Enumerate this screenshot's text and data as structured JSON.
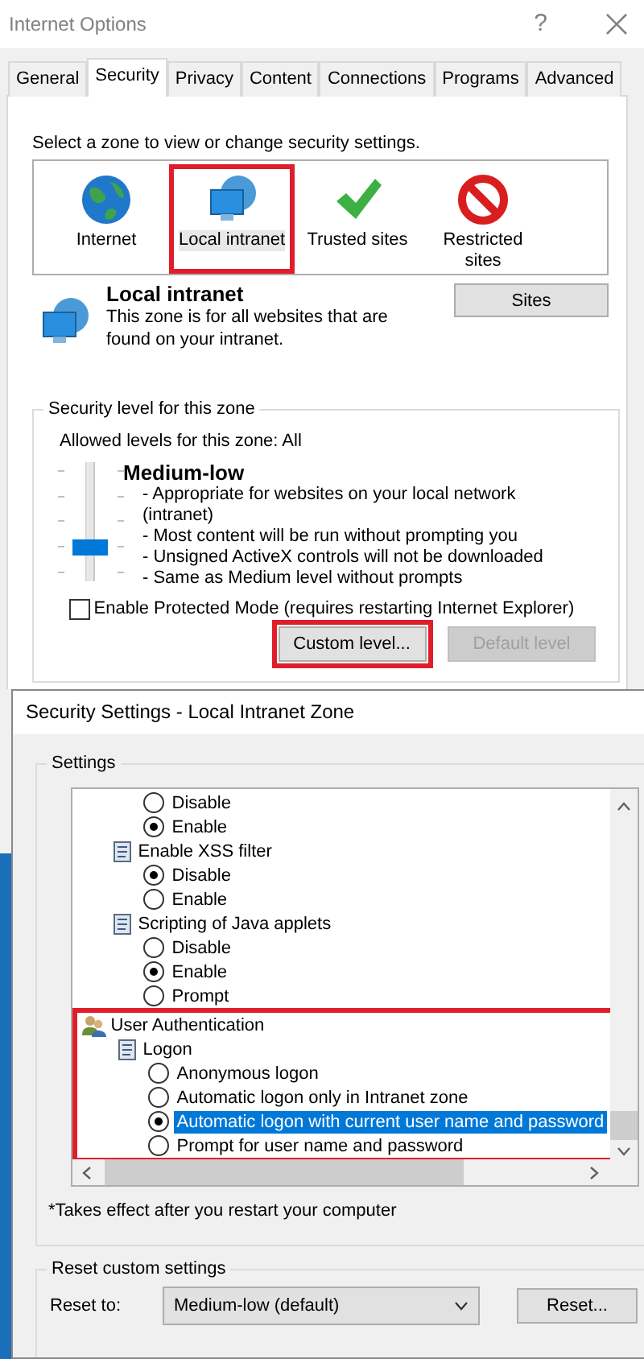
{
  "window": {
    "title": "Internet Options",
    "help": "?"
  },
  "tabs": [
    {
      "label": "General",
      "selected": false
    },
    {
      "label": "Security",
      "selected": true
    },
    {
      "label": "Privacy",
      "selected": false
    },
    {
      "label": "Content",
      "selected": false
    },
    {
      "label": "Connections",
      "selected": false
    },
    {
      "label": "Programs",
      "selected": false
    },
    {
      "label": "Advanced",
      "selected": false
    }
  ],
  "zone_prompt": "Select a zone to view or change security settings.",
  "zones": [
    {
      "label": "Internet",
      "kind": "globe",
      "selected": false,
      "highlighted": false
    },
    {
      "label": "Local intranet",
      "kind": "intranet",
      "selected": true,
      "highlighted": true
    },
    {
      "label": "Trusted sites",
      "kind": "trusted",
      "selected": false,
      "highlighted": false
    },
    {
      "label": "Restricted sites",
      "kind": "restricted",
      "selected": false,
      "highlighted": false
    }
  ],
  "zone_info": {
    "title": "Local intranet",
    "description": "This zone is for all websites that are found on your intranet.",
    "button": "Sites"
  },
  "security_level": {
    "legend": "Security level for this zone",
    "allowed": "Allowed levels for this zone: All",
    "level": 0.25,
    "name": "Medium-low",
    "bullets": [
      "- Appropriate for websites on your local network (intranet)",
      "- Most content will be run without prompting you",
      "- Unsigned ActiveX controls will not be downloaded",
      "- Same as Medium level without prompts"
    ]
  },
  "protected_mode": {
    "label": "Enable Protected Mode (requires restarting Internet Explorer)",
    "checked": false
  },
  "buttons": [
    {
      "label": "Custom level...",
      "disabled": false,
      "highlighted": true
    },
    {
      "label": "Default level",
      "disabled": true,
      "highlighted": false
    }
  ],
  "dialog": {
    "title": "Security Settings - Local Intranet Zone",
    "settings_legend": "Settings",
    "tree": [
      {
        "kind": "radio",
        "label": "Disable",
        "checked": false,
        "selected": false
      },
      {
        "kind": "radio",
        "label": "Enable",
        "checked": true,
        "selected": false
      },
      {
        "kind": "setting",
        "label": "Enable XSS filter",
        "children": [
          {
            "kind": "radio",
            "label": "Disable",
            "checked": true,
            "selected": false
          },
          {
            "kind": "radio",
            "label": "Enable",
            "checked": false,
            "selected": false
          }
        ]
      },
      {
        "kind": "setting",
        "label": "Scripting of Java applets",
        "children": [
          {
            "kind": "radio",
            "label": "Disable",
            "checked": false,
            "selected": false
          },
          {
            "kind": "radio",
            "label": "Enable",
            "checked": true,
            "selected": false
          },
          {
            "kind": "radio",
            "label": "Prompt",
            "checked": false,
            "selected": false
          }
        ]
      },
      {
        "kind": "category",
        "label": "User Authentication",
        "highlighted": true,
        "children": [
          {
            "kind": "setting",
            "label": "Logon",
            "children": [
              {
                "kind": "radio",
                "label": "Anonymous logon",
                "checked": false,
                "selected": false
              },
              {
                "kind": "radio",
                "label": "Automatic logon only in Intranet zone",
                "checked": false,
                "selected": false
              },
              {
                "kind": "radio",
                "label": "Automatic logon with current user name and password",
                "checked": true,
                "selected": true
              },
              {
                "kind": "radio",
                "label": "Prompt for user name and password",
                "checked": false,
                "selected": false
              }
            ]
          }
        ]
      }
    ],
    "note": "*Takes effect after you restart your computer",
    "reset_legend": "Reset custom settings",
    "reset_label": "Reset to:",
    "reset_value": "Medium-low (default)",
    "reset_button": "Reset..."
  }
}
